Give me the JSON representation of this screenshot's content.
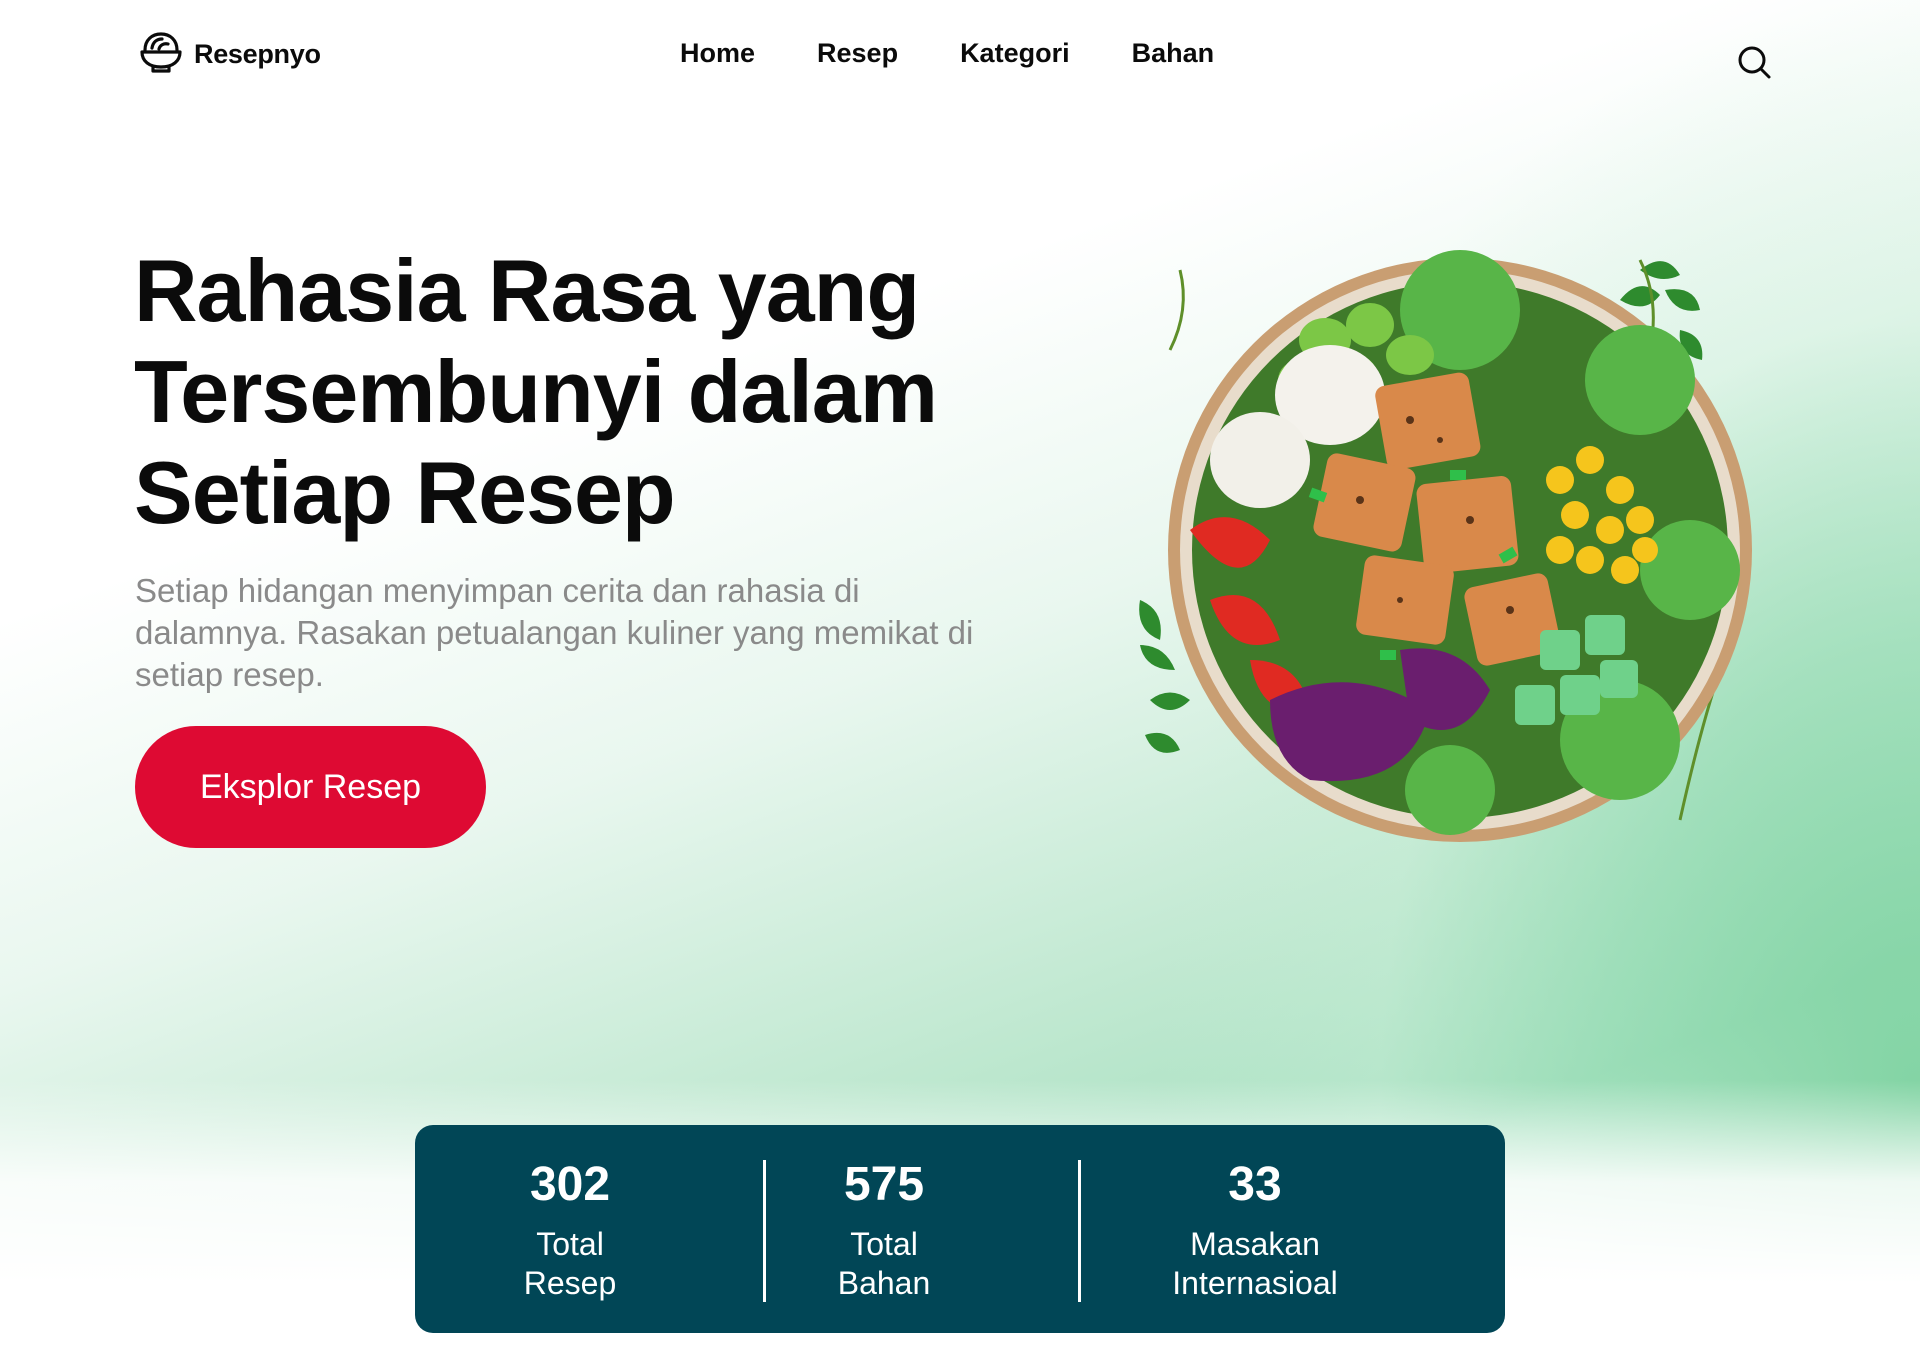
{
  "brand": {
    "name": "Resepnyo",
    "logo_icon": "bowl-icon"
  },
  "nav": {
    "items": [
      {
        "label": "Home"
      },
      {
        "label": "Resep"
      },
      {
        "label": "Kategori"
      },
      {
        "label": "Bahan"
      }
    ],
    "search_icon": "search-icon"
  },
  "hero": {
    "title_line1": "Rahasia Rasa yang",
    "title_line2": "Tersembunyi dalam",
    "title_line3": "Setiap Resep",
    "subtitle": "Setiap hidangan menyimpan cerita dan rahasia di dalamnya. Rasakan petualangan kuliner yang memikat di setiap resep.",
    "cta_label": "Eksplor Resep"
  },
  "stats": [
    {
      "value": "302",
      "label_line1": "Total",
      "label_line2": "Resep"
    },
    {
      "value": "575",
      "label_line1": "Total",
      "label_line2": "Bahan"
    },
    {
      "value": "33",
      "label_line1": "Masakan",
      "label_line2": "Internasioal"
    }
  ],
  "colors": {
    "accent": "#de0a33",
    "stats_bg": "#014656",
    "text": "#0b0b0b",
    "muted": "#8a8a8a",
    "gradient_green": "#a6e0c0"
  }
}
